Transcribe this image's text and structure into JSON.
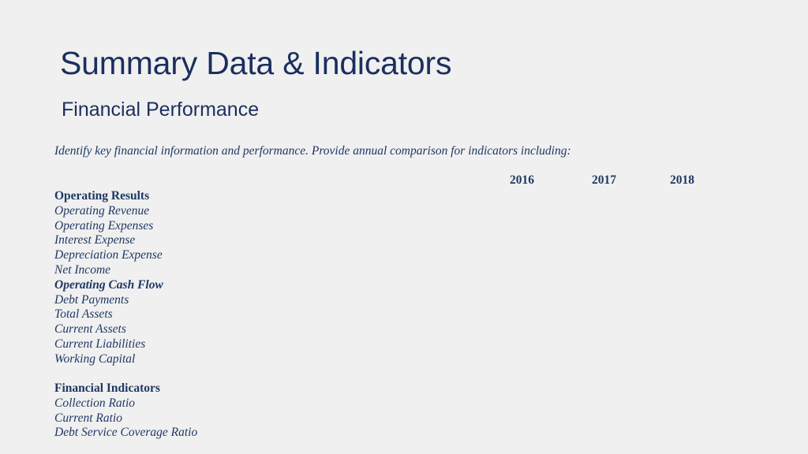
{
  "slide": {
    "title": "Summary Data & Indicators",
    "subtitle": "Financial Performance",
    "lead": "Identify key financial information and performance. Provide annual comparison for indicators including:",
    "colors": {
      "background": "#f0f0f0",
      "title_navy": "#1b2f5e",
      "body_navy": "#1f3864"
    },
    "years": [
      "2016",
      "2017",
      "2018"
    ],
    "sections": [
      {
        "heading": "Operating Results",
        "heading_style": "bold",
        "items": [
          {
            "label": "Operating Revenue",
            "style": "italic"
          },
          {
            "label": "Operating Expenses",
            "style": "italic"
          },
          {
            "label": "Interest Expense",
            "style": "italic"
          },
          {
            "label": "Depreciation Expense",
            "style": "italic"
          },
          {
            "label": "Net Income",
            "style": "italic"
          },
          {
            "label": "Operating Cash Flow",
            "style": "bold-italic"
          },
          {
            "label": "Debt Payments",
            "style": "italic"
          },
          {
            "label": "Total Assets",
            "style": "italic"
          },
          {
            "label": "Current Assets",
            "style": "italic"
          },
          {
            "label": "Current Liabilities",
            "style": "italic"
          },
          {
            "label": "Working Capital",
            "style": "italic"
          }
        ]
      },
      {
        "heading": "Financial Indicators",
        "heading_style": "bold",
        "items": [
          {
            "label": "Collection Ratio",
            "style": "italic"
          },
          {
            "label": "Current Ratio",
            "style": "italic"
          },
          {
            "label": "Debt Service Coverage Ratio",
            "style": "italic"
          }
        ]
      }
    ]
  }
}
